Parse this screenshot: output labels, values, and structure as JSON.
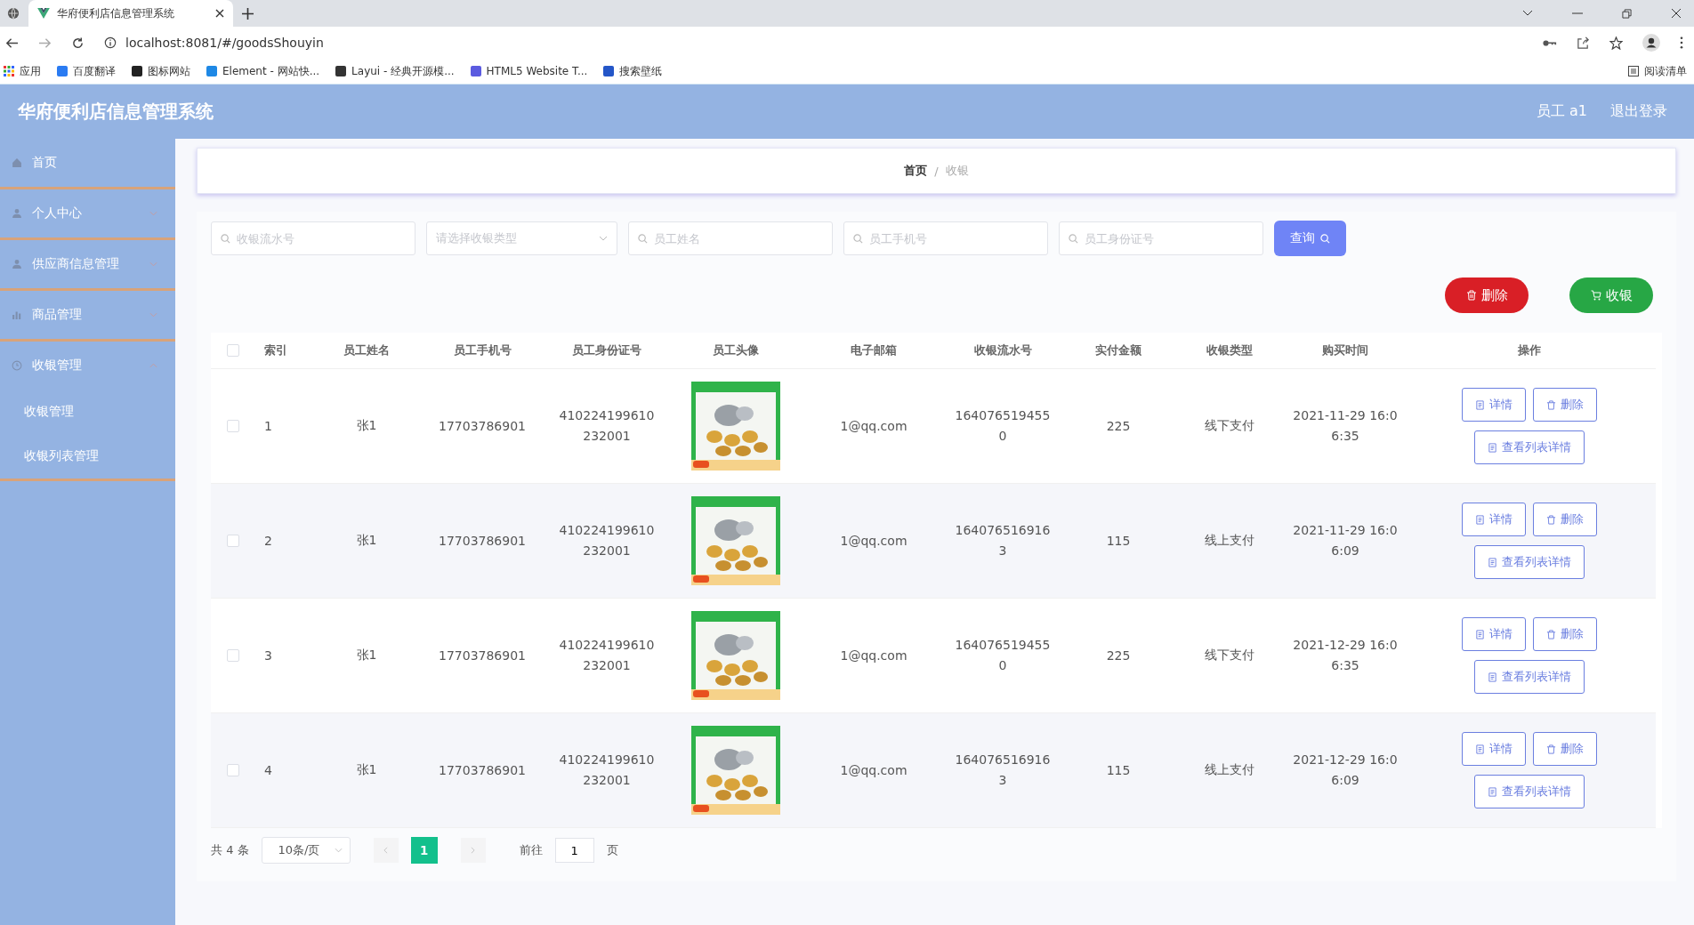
{
  "browser": {
    "tab_title": "华府便利店信息管理系统",
    "url": "localhost:8081/#/goodsShouyin",
    "bookmarks": [
      "应用",
      "百度翻译",
      "图标网站",
      "Element - 网站快...",
      "Layui - 经典开源模...",
      "HTML5 Website T...",
      "搜索壁纸"
    ],
    "reading_list": "阅读清单"
  },
  "header": {
    "title": "华府便利店信息管理系统",
    "user": "员工 a1",
    "logout": "退出登录"
  },
  "sidebar": {
    "items": [
      {
        "label": "首页"
      },
      {
        "label": "个人中心",
        "expanded": false
      },
      {
        "label": "供应商信息管理",
        "expanded": false
      },
      {
        "label": "商品管理",
        "expanded": false
      },
      {
        "label": "收银管理",
        "expanded": true,
        "children": [
          {
            "label": "收银管理"
          },
          {
            "label": "收银列表管理"
          }
        ]
      }
    ]
  },
  "breadcrumb": {
    "items": [
      "首页",
      "收银"
    ],
    "separator": "/"
  },
  "filters": [
    {
      "kind": "input",
      "placeholder": "收银流水号"
    },
    {
      "kind": "select",
      "placeholder": "请选择收银类型"
    },
    {
      "kind": "input",
      "placeholder": "员工姓名"
    },
    {
      "kind": "input",
      "placeholder": "员工手机号"
    },
    {
      "kind": "input",
      "placeholder": "员工身份证号"
    }
  ],
  "search_button": "查询",
  "actions": [
    {
      "kind": "delete",
      "label": "删除"
    },
    {
      "kind": "cashier",
      "label": "收银"
    }
  ],
  "table": {
    "columns": [
      "索引",
      "员工姓名",
      "员工手机号",
      "员工身份证号",
      "员工头像",
      "电子邮箱",
      "收银流水号",
      "实付金额",
      "收银类型",
      "购买时间",
      "操作"
    ],
    "header_checked": false,
    "rows": [
      {
        "checked": false,
        "index": "1",
        "name": "张1",
        "phone": "17703786901",
        "id_card": "410224199610232001",
        "avatar": {
          "kind": "picture"
        },
        "email": "1@qq.com",
        "serial": "1640765194550",
        "amount": "225",
        "type": "线下支付",
        "time": "2021-11-29 16:06:35",
        "ops": [
          "详情",
          "删除",
          "查看列表详情"
        ]
      },
      {
        "checked": false,
        "index": "2",
        "name": "张1",
        "phone": "17703786901",
        "id_card": "410224199610232001",
        "avatar": {
          "kind": "picture"
        },
        "email": "1@qq.com",
        "serial": "1640765169163",
        "amount": "115",
        "type": "线上支付",
        "time": "2021-11-29 16:06:09",
        "ops": [
          "详情",
          "删除",
          "查看列表详情"
        ]
      },
      {
        "checked": false,
        "index": "3",
        "name": "张1",
        "phone": "17703786901",
        "id_card": "410224199610232001",
        "avatar": {
          "kind": "picture"
        },
        "email": "1@qq.com",
        "serial": "1640765194550",
        "amount": "225",
        "type": "线下支付",
        "time": "2021-12-29 16:06:35",
        "ops": [
          "详情",
          "删除",
          "查看列表详情"
        ]
      },
      {
        "checked": false,
        "index": "4",
        "name": "张1",
        "phone": "17703786901",
        "id_card": "410224199610232001",
        "avatar": {
          "kind": "picture"
        },
        "email": "1@qq.com",
        "serial": "1640765169163",
        "amount": "115",
        "type": "线上支付",
        "time": "2021-12-29 16:06:09",
        "ops": [
          "详情",
          "删除",
          "查看列表详情"
        ]
      }
    ]
  },
  "pagination": {
    "total": "共 4 条",
    "page_size": "10条/页",
    "pages": [
      {
        "label": "1",
        "selected": true
      }
    ],
    "goto": "前往",
    "goto_value": "1",
    "goto_suffix": "页"
  }
}
